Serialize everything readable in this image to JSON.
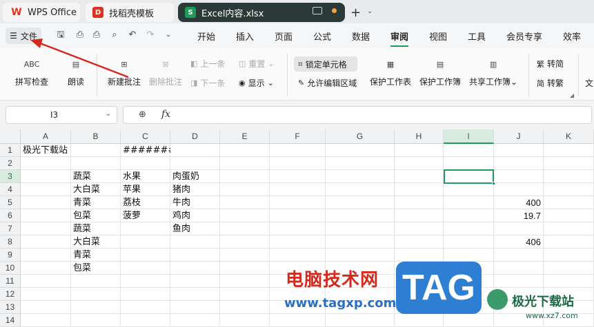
{
  "titlebar": {
    "tabs": [
      {
        "label": "WPS Office",
        "icon": "wps-logo-icon"
      },
      {
        "label": "找稻壳模板",
        "icon": "docer-icon"
      },
      {
        "label": "Excel内容.xlsx",
        "icon": "spreadsheet-icon",
        "icon_letter": "S"
      }
    ]
  },
  "menubar": {
    "file_label": "文件",
    "items": [
      "开始",
      "插入",
      "页面",
      "公式",
      "数据",
      "审阅",
      "视图",
      "工具",
      "会员专享",
      "效率"
    ],
    "active": "审阅"
  },
  "ribbon": {
    "spellcheck": "拼写检查",
    "spellcheck_icon_text": "ABC",
    "read_aloud": "朗读",
    "new_comment": "新建批注",
    "delete_comment": "删除批注",
    "prev": "上一条",
    "next": "下一条",
    "reset": "重置",
    "show": "显示",
    "lock_cell": "锁定单元格",
    "allow_edit_range": "允许编辑区域",
    "protect_sheet": "保护工作表",
    "protect_workbook": "保护工作簿",
    "share_workbook": "共享工作簿",
    "to_traditional": "转简",
    "to_simplified": "转繁",
    "last_partial": "文"
  },
  "formula_bar": {
    "cell_ref": "I3",
    "fx_label": "fx",
    "content": ""
  },
  "sheet": {
    "columns": [
      "A",
      "B",
      "C",
      "D",
      "E",
      "F",
      "G",
      "H",
      "I",
      "J",
      "K"
    ],
    "rows": [
      "1",
      "2",
      "3",
      "4",
      "5",
      "6",
      "7",
      "8",
      "9",
      "10",
      "11",
      "12",
      "13",
      "14"
    ],
    "selected_col": "I",
    "selected_row": "3",
    "cells": {
      "A1": "极光下载站",
      "C1": "########",
      "B3": "蔬菜",
      "C3": "水果",
      "D3": "肉蛋奶",
      "B4": "大白菜",
      "C4": "苹果",
      "D4": "猪肉",
      "B5": "青菜",
      "C5": "荔枝",
      "D5": "牛肉",
      "J5": "400",
      "B6": "包菜",
      "C6": "菠萝",
      "D6": "鸡肉",
      "J6": "19.7",
      "B7": "蔬菜",
      "D7": "鱼肉",
      "B8": "大白菜",
      "J8": "406",
      "B9": "青菜",
      "B10": "包菜"
    }
  },
  "watermark": {
    "title": "电脑技术网",
    "url": "www.tagxp.com",
    "tag": "TAG",
    "site": "极光下载站",
    "site_url": "www.xz7.com"
  },
  "colors": {
    "accent": "#1e9b5a",
    "arrow": "#d42a1e"
  }
}
